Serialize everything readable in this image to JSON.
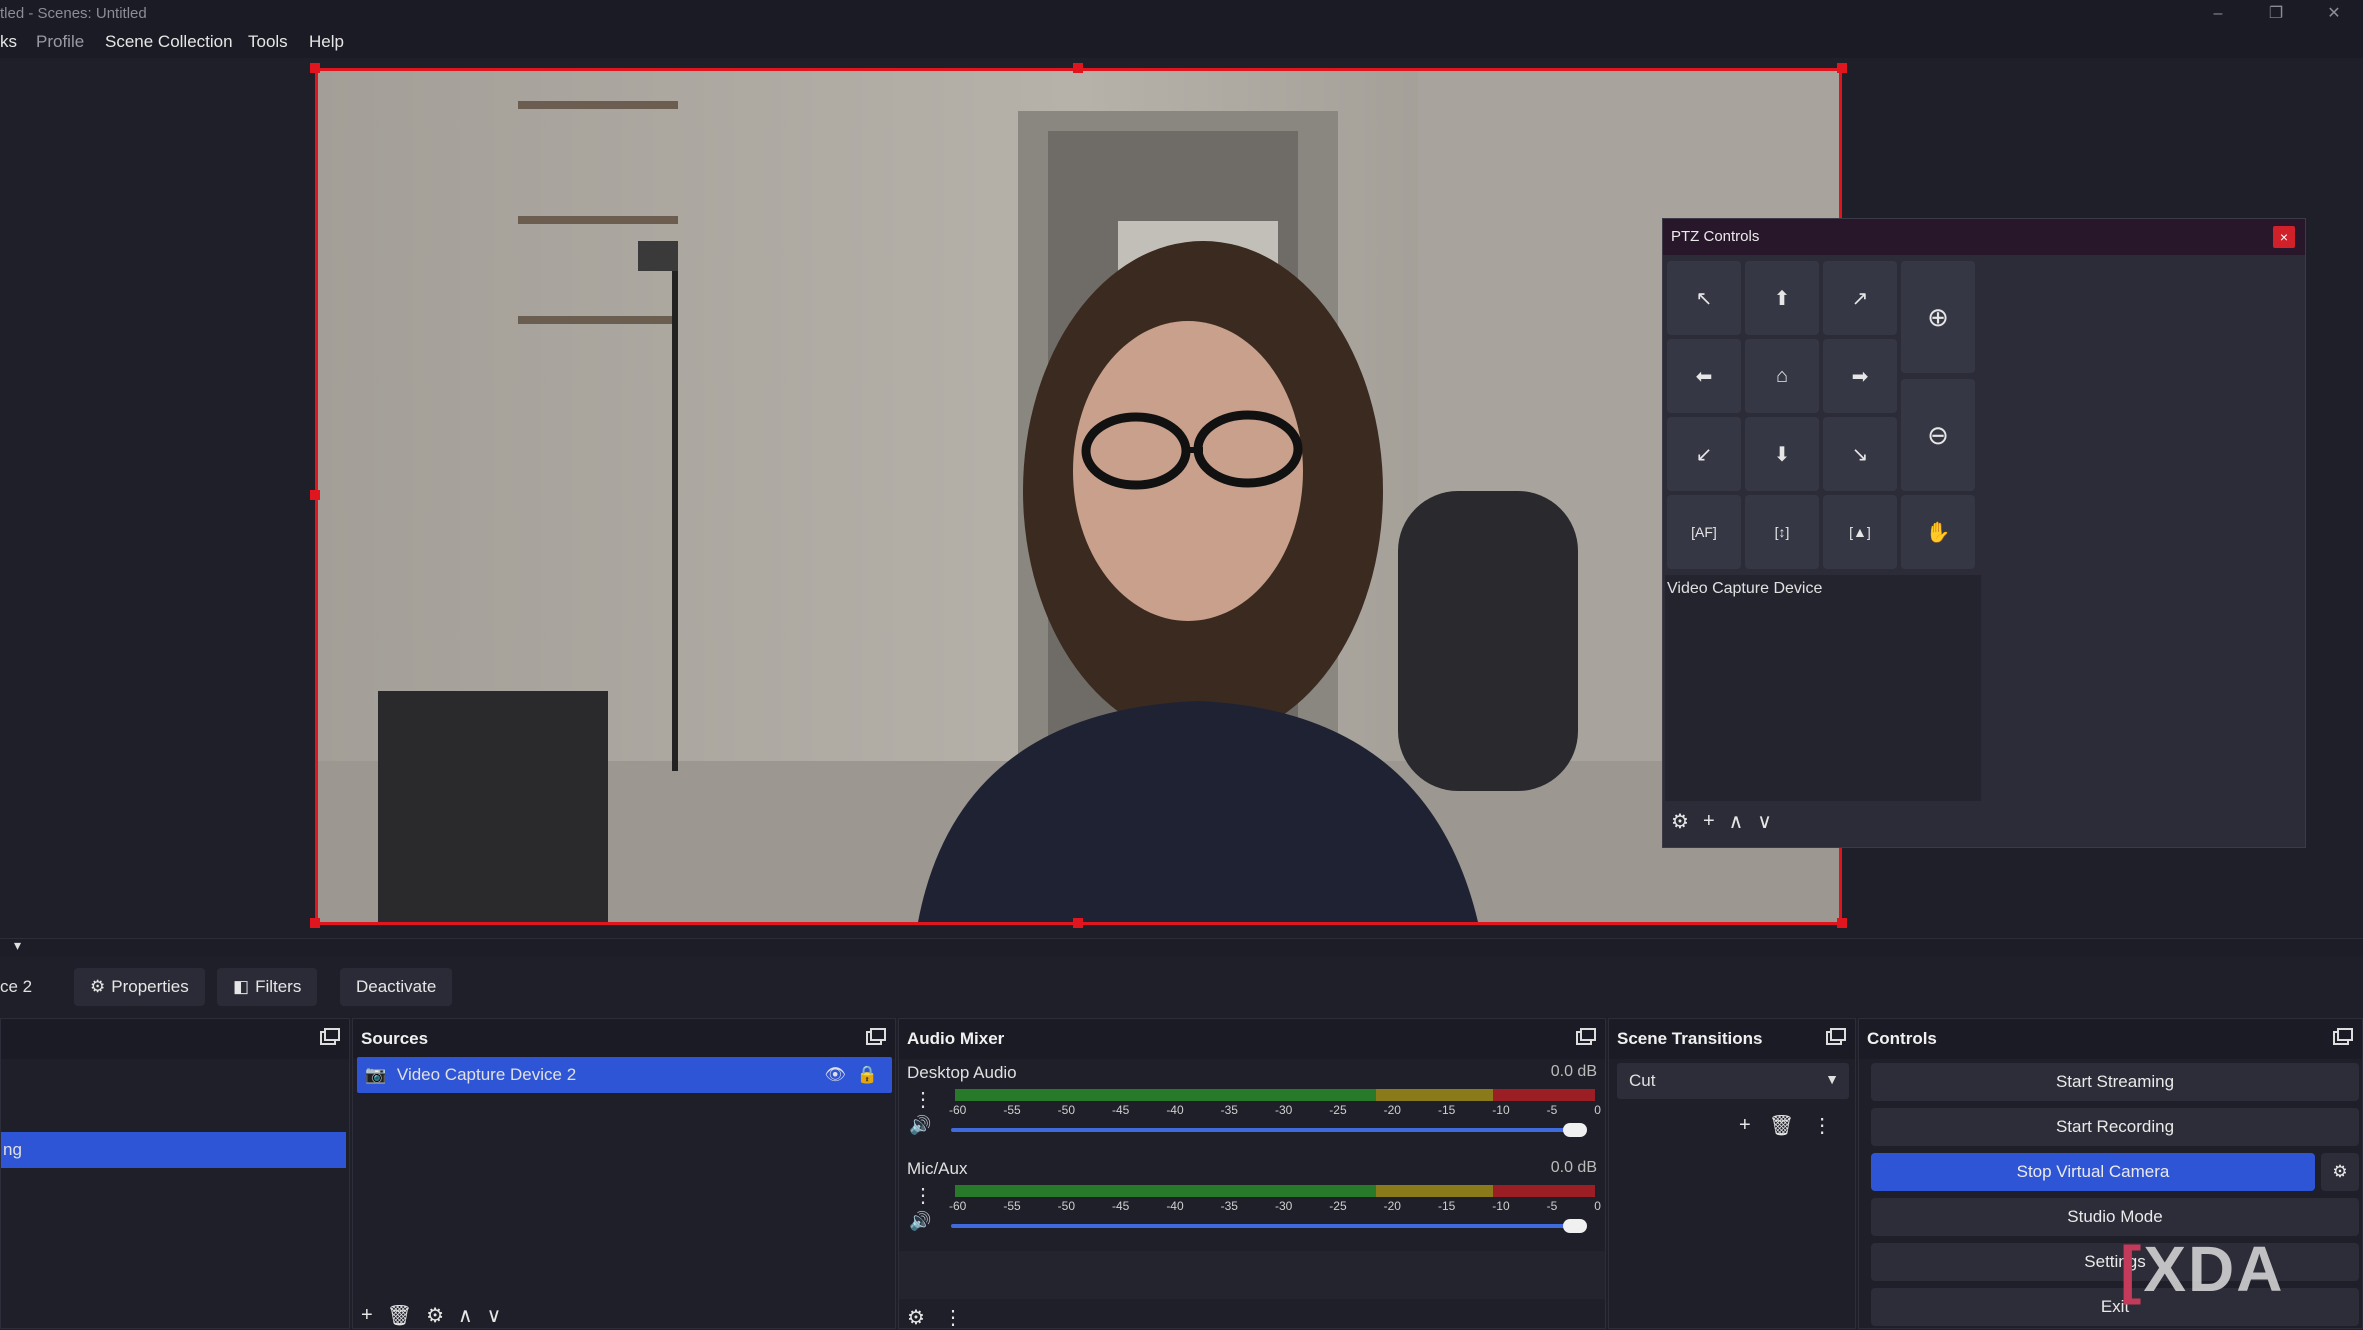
{
  "window": {
    "title": "tled - Scenes: Untitled",
    "controls": [
      "–",
      "❐",
      "✕"
    ]
  },
  "menu": {
    "items": [
      "ks",
      "Profile",
      "Scene Collection",
      "Tools",
      "Help"
    ]
  },
  "toolbar": {
    "scene_label": "ce 2",
    "properties": "Properties",
    "filters": "Filters",
    "deactivate": "Deactivate"
  },
  "ptz": {
    "title": "PTZ Controls",
    "close": "×",
    "device": "Video Capture Device",
    "buttons": [
      "↖",
      "⬆",
      "↗",
      "⬅",
      "⌂",
      "➡",
      "↙",
      "⬇",
      "↘"
    ],
    "zoom_in": "⊕",
    "zoom_out": "⊖",
    "bottom_row": [
      "[AF]",
      "[↕]",
      "[▲]",
      "✋"
    ],
    "footer": [
      "⚙",
      "+",
      "∧",
      "∨"
    ]
  },
  "scenes": {
    "selected_label": "ng"
  },
  "sources": {
    "title": "Sources",
    "items": [
      {
        "label": "Video Capture Device 2",
        "visible": true,
        "locked": true
      }
    ],
    "footer": [
      "+",
      "🗑",
      "⚙",
      "∧",
      "∨"
    ]
  },
  "audio_mixer": {
    "title": "Audio Mixer",
    "channels": [
      {
        "name": "Desktop Audio",
        "db": "0.0 dB",
        "volume": 1.0
      },
      {
        "name": "Mic/Aux",
        "db": "0.0 dB",
        "volume": 1.0
      }
    ],
    "scale": [
      "-60",
      "-55",
      "-50",
      "-45",
      "-40",
      "-35",
      "-30",
      "-25",
      "-20",
      "-15",
      "-10",
      "-5",
      "0"
    ],
    "colors": {
      "green": "#2a8a2a",
      "yellow": "#8a7a1a",
      "red": "#9a1e24"
    }
  },
  "scene_transitions": {
    "title": "Scene Transitions",
    "selected": "Cut"
  },
  "controls": {
    "title": "Controls",
    "start_streaming": "Start Streaming",
    "start_recording": "Start Recording",
    "stop_virtual_camera": "Stop Virtual Camera",
    "studio_mode": "Studio Mode",
    "settings": "Settings",
    "exit": "Exit"
  },
  "watermark": {
    "text": "XDA"
  },
  "accent": "#2e55d6",
  "selection_color": "#e0151d"
}
